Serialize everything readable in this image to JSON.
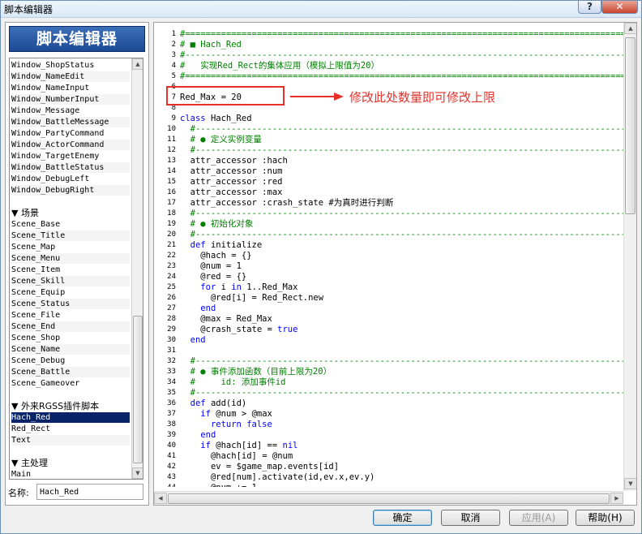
{
  "window": {
    "title": "脚本编辑器",
    "help_glyph": "?",
    "close_glyph": "✕"
  },
  "header": {
    "title": "脚本编辑器"
  },
  "script_list": {
    "items": [
      {
        "label": "Window_ShopStatus",
        "kind": "item"
      },
      {
        "label": "Window_NameEdit",
        "kind": "item"
      },
      {
        "label": "Window_NameInput",
        "kind": "item"
      },
      {
        "label": "Window_NumberInput",
        "kind": "item"
      },
      {
        "label": "Window_Message",
        "kind": "item"
      },
      {
        "label": "Window_BattleMessage",
        "kind": "item"
      },
      {
        "label": "Window_PartyCommand",
        "kind": "item"
      },
      {
        "label": "Window_ActorCommand",
        "kind": "item"
      },
      {
        "label": "Window_TargetEnemy",
        "kind": "item"
      },
      {
        "label": "Window_BattleStatus",
        "kind": "item"
      },
      {
        "label": "Window_DebugLeft",
        "kind": "item"
      },
      {
        "label": "Window_DebugRight",
        "kind": "item"
      },
      {
        "label": "",
        "kind": "blank"
      },
      {
        "label": "▼ 场景",
        "kind": "category"
      },
      {
        "label": "Scene_Base",
        "kind": "item"
      },
      {
        "label": "Scene_Title",
        "kind": "item"
      },
      {
        "label": "Scene_Map",
        "kind": "item"
      },
      {
        "label": "Scene_Menu",
        "kind": "item"
      },
      {
        "label": "Scene_Item",
        "kind": "item"
      },
      {
        "label": "Scene_Skill",
        "kind": "item"
      },
      {
        "label": "Scene_Equip",
        "kind": "item"
      },
      {
        "label": "Scene_Status",
        "kind": "item"
      },
      {
        "label": "Scene_File",
        "kind": "item"
      },
      {
        "label": "Scene_End",
        "kind": "item"
      },
      {
        "label": "Scene_Shop",
        "kind": "item"
      },
      {
        "label": "Scene_Name",
        "kind": "item"
      },
      {
        "label": "Scene_Debug",
        "kind": "item"
      },
      {
        "label": "Scene_Battle",
        "kind": "item"
      },
      {
        "label": "Scene_Gameover",
        "kind": "item"
      },
      {
        "label": "",
        "kind": "blank"
      },
      {
        "label": "▼ 外来RGSS插件脚本",
        "kind": "category"
      },
      {
        "label": "Hach_Red",
        "kind": "item",
        "selected": true
      },
      {
        "label": "Red_Rect",
        "kind": "item"
      },
      {
        "label": "Text",
        "kind": "item"
      },
      {
        "label": "",
        "kind": "blank"
      },
      {
        "label": "▼ 主处理",
        "kind": "category"
      },
      {
        "label": "Main",
        "kind": "item"
      }
    ]
  },
  "name_field": {
    "label": "名称:",
    "value": "Hach_Red"
  },
  "editor": {
    "lines": [
      {
        "n": "1",
        "t": "#======================================================================================",
        "c": "cm"
      },
      {
        "n": "2",
        "t": "# ■ Hach_Red",
        "c": "cm"
      },
      {
        "n": "3",
        "t": "#--------------------------------------------------------------------------------------",
        "c": "cm"
      },
      {
        "n": "4",
        "t": "#   实现Red_Rect的集体应用（模拟上限值为20）",
        "c": "cm"
      },
      {
        "n": "5",
        "t": "#======================================================================================",
        "c": "cm"
      },
      {
        "n": "6",
        "t": "",
        "c": ""
      },
      {
        "n": "7",
        "t": "Red_Max = 20",
        "c": ""
      },
      {
        "n": "8",
        "t": "",
        "c": ""
      },
      {
        "n": "9",
        "t": "class Hach_Red",
        "c": "kwcls"
      },
      {
        "n": "10",
        "t": "  #------------------------------------------------------------------------------------",
        "c": "cm"
      },
      {
        "n": "11",
        "t": "  # ● 定义实例变量",
        "c": "cm"
      },
      {
        "n": "12",
        "t": "  #------------------------------------------------------------------------------------",
        "c": "cm"
      },
      {
        "n": "13",
        "t": "  attr_accessor :hach",
        "c": ""
      },
      {
        "n": "14",
        "t": "  attr_accessor :num",
        "c": ""
      },
      {
        "n": "15",
        "t": "  attr_accessor :red",
        "c": ""
      },
      {
        "n": "16",
        "t": "  attr_accessor :max",
        "c": ""
      },
      {
        "n": "17",
        "t": "  attr_accessor :crash_state #为真时进行判断",
        "c": "tailcm"
      },
      {
        "n": "18",
        "t": "  #------------------------------------------------------------------------------------",
        "c": "cm"
      },
      {
        "n": "19",
        "t": "  # ● 初始化对象",
        "c": "cm"
      },
      {
        "n": "20",
        "t": "  #------------------------------------------------------------------------------------",
        "c": "cm"
      },
      {
        "n": "21",
        "t": "  def initialize",
        "c": "def"
      },
      {
        "n": "22",
        "t": "    @hach = {}",
        "c": ""
      },
      {
        "n": "23",
        "t": "    @num = 1",
        "c": ""
      },
      {
        "n": "24",
        "t": "    @red = {}",
        "c": ""
      },
      {
        "n": "25",
        "t": "    for i in 1..Red_Max",
        "c": "for"
      },
      {
        "n": "26",
        "t": "      @red[i] = Red_Rect.new",
        "c": ""
      },
      {
        "n": "27",
        "t": "    end",
        "c": "kw"
      },
      {
        "n": "28",
        "t": "    @max = Red_Max",
        "c": ""
      },
      {
        "n": "29",
        "t": "    @crash_state = true",
        "c": "true"
      },
      {
        "n": "30",
        "t": "  end",
        "c": "kw"
      },
      {
        "n": "31",
        "t": "",
        "c": ""
      },
      {
        "n": "32",
        "t": "  #------------------------------------------------------------------------------------",
        "c": "cm"
      },
      {
        "n": "33",
        "t": "  # ● 事件添加函数（目前上限为20）",
        "c": "cm"
      },
      {
        "n": "34",
        "t": "  #     id: 添加事件id",
        "c": "cm"
      },
      {
        "n": "35",
        "t": "  #------------------------------------------------------------------------------------",
        "c": "cm"
      },
      {
        "n": "36",
        "t": "  def add(id)",
        "c": "def"
      },
      {
        "n": "37",
        "t": "    if @num > @max",
        "c": "if"
      },
      {
        "n": "38",
        "t": "      return false",
        "c": "kw"
      },
      {
        "n": "39",
        "t": "    end",
        "c": "kw"
      },
      {
        "n": "40",
        "t": "    if @hach[id] == nil",
        "c": "if"
      },
      {
        "n": "41",
        "t": "      @hach[id] = @num",
        "c": ""
      },
      {
        "n": "42",
        "t": "      ev = $game_map.events[id]",
        "c": ""
      },
      {
        "n": "43",
        "t": "      @red[num].activate(id,ev.x,ev.y)",
        "c": ""
      },
      {
        "n": "44",
        "t": "      @num += 1",
        "c": ""
      }
    ]
  },
  "annotation": {
    "text": "修改此处数量即可修改上限"
  },
  "buttons": {
    "ok": "确定",
    "cancel": "取消",
    "apply": "应用(A)",
    "help": "帮助(H)"
  },
  "colors": {
    "comment": "#008000",
    "keyword": "#0000ff",
    "annotation": "#e8302a",
    "banner": "#2a5aa6",
    "selection": "#0a246a"
  }
}
